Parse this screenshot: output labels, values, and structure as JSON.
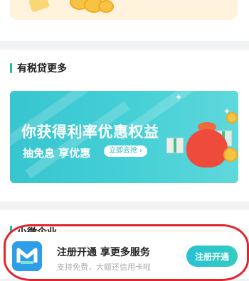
{
  "promo_section": {
    "title": "有税贷更多",
    "banner_title": "你获得利率优惠权益",
    "banner_subtitle": "抽免息 享优惠",
    "cta_label": "立即去抢",
    "cta_icon": "chevron-right-icon"
  },
  "next_section": {
    "title_partial": "小微企业"
  },
  "register_bar": {
    "title": "注册开通 享更多服务",
    "subtitle": "支持免费，大额还信用卡啦",
    "button_label": "注册开通",
    "logo_icon": "app-logo-icon"
  },
  "colors": {
    "accent": "#1fbfa4",
    "banner": "#3fc9d1",
    "annotation": "#e4232a"
  }
}
